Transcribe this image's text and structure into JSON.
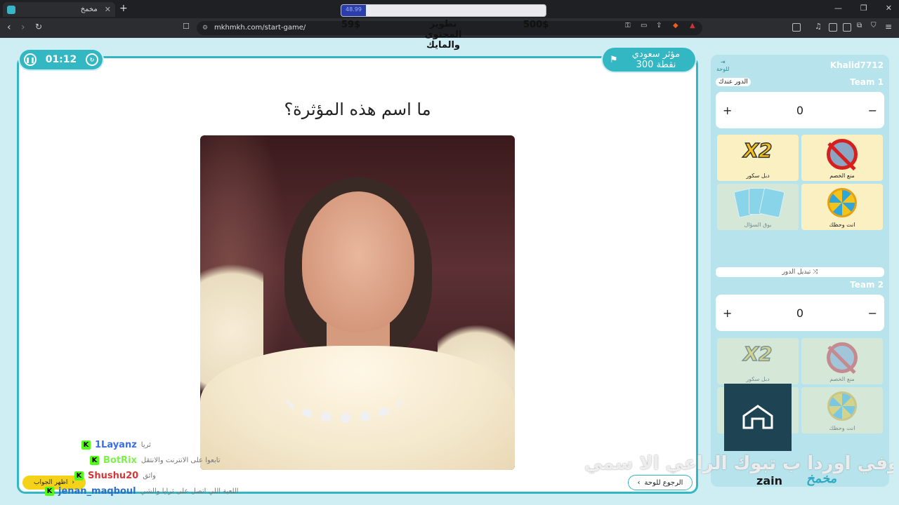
{
  "browser": {
    "tab_title": "مخمخ",
    "url": "mkhmkh.com/start-game/"
  },
  "overlay": {
    "progress_value": "48.99",
    "progress_fraction": 0.12,
    "amount_left": "59$",
    "amount_right": "500$",
    "goal_title_1": "تطوير",
    "goal_title_2": "المحتوى",
    "goal_title_3": "والمايك"
  },
  "game": {
    "timer": "01:12",
    "category": "مؤثر سعودي",
    "points": "300 نقطة",
    "question": "ما اسم هذه المؤثرة؟",
    "back_button": "الرجوع للوحة",
    "show_answer_button": "اظهر الجواب"
  },
  "chat": [
    {
      "user": "1Layanz",
      "color": "#3a6ee8",
      "text": "ثريا"
    },
    {
      "user": "BotRix",
      "color": "#7cf24a",
      "text": "تابعوا على الانترنت والانتقل"
    },
    {
      "user": "Shushu20",
      "color": "#d23a3a",
      "text": "واثق"
    },
    {
      "user": "jenan_maqboul",
      "color": "#2d6fc8",
      "text": "اللعبة اللي اتصل على ثرايا والشي"
    }
  ],
  "panel": {
    "username": "Khalid7712",
    "board_label": "للوحة",
    "team1": {
      "label": "Team 1",
      "turn": "الدور عندك",
      "score": "0"
    },
    "team2": {
      "label": "Team 2",
      "score": "0"
    },
    "switch_turn": "تبديل الدور",
    "helpers": [
      "منع الخصم",
      "دبل سكور",
      "انت وحظك",
      "بوق السؤال"
    ]
  },
  "footer": {
    "scroll_text": "كوفي اوردا ب تبوك الراعي الا سمي",
    "sponsor": "zain",
    "logo": "مخمخ"
  }
}
